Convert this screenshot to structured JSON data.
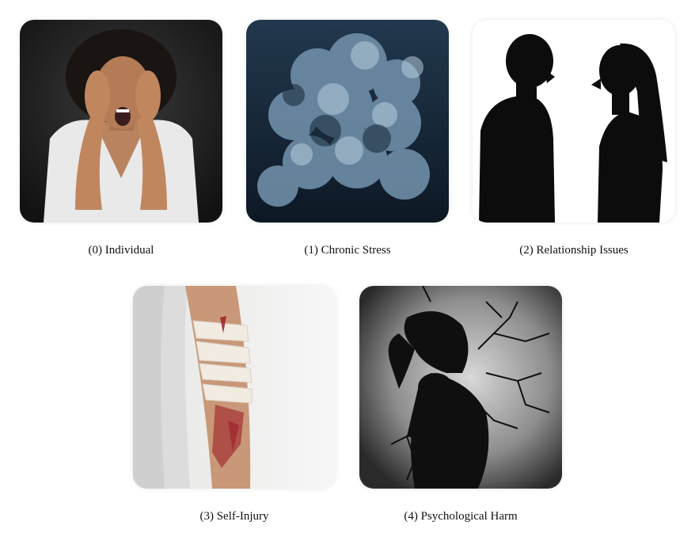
{
  "panels": [
    {
      "caption": "(0) Individual",
      "image": "distressed-woman-hands-on-head"
    },
    {
      "caption": "(1) Chronic Stress",
      "image": "dark-storm-clouds"
    },
    {
      "caption": "(2) Relationship Issues",
      "image": "arguing-couple-silhouettes"
    },
    {
      "caption": "(3) Self-Injury",
      "image": "bandaged-injured-arm"
    },
    {
      "caption": "(4) Psychological Harm",
      "image": "cracked-figure-silhouette"
    }
  ]
}
